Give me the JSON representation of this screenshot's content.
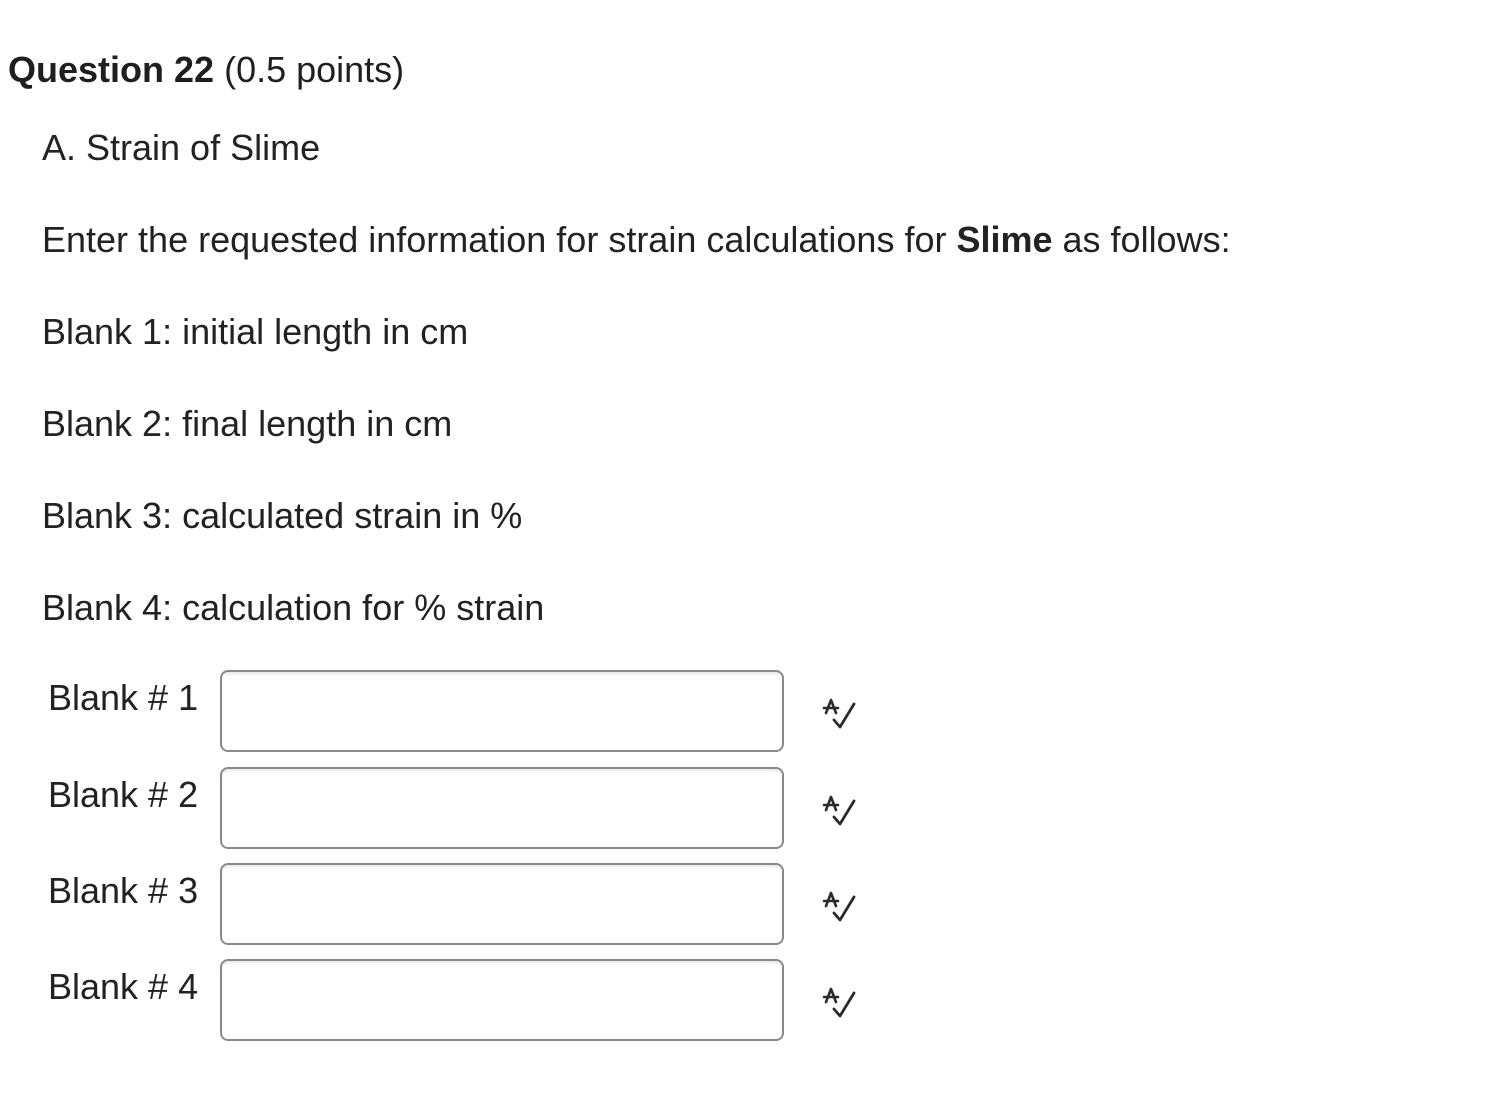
{
  "question": {
    "label": "Question 22",
    "points": "(0.5 points)"
  },
  "content": {
    "section_title": "A. Strain of Slime",
    "instruction_before": "Enter the requested information for strain calculations for ",
    "instruction_bold": "Slime",
    "instruction_after": " as follows:",
    "items": [
      "Blank 1: initial length in cm",
      "Blank 2: final length in cm",
      "Blank 3: calculated strain in %",
      "Blank 4: calculation for % strain"
    ]
  },
  "blanks": [
    {
      "label": "Blank # 1",
      "value": "",
      "icon": "spell-check-icon"
    },
    {
      "label": "Blank # 2",
      "value": "",
      "icon": "spell-check-icon"
    },
    {
      "label": "Blank # 3",
      "value": "",
      "icon": "spell-check-icon"
    },
    {
      "label": "Blank # 4",
      "value": "",
      "icon": "spell-check-icon"
    }
  ]
}
